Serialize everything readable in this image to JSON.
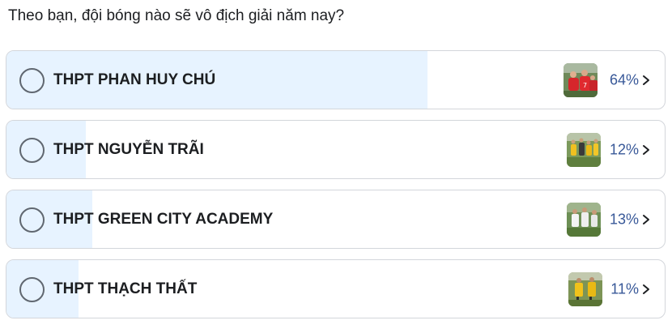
{
  "poll": {
    "question": "Theo bạn, đội bóng nào sẽ vô địch giải năm nay?",
    "options": [
      {
        "label": "THPT PHAN HUY CHÚ",
        "percent_text": "64%",
        "percent": 64,
        "image_icon": "team-photo-red-jerseys"
      },
      {
        "label": "THPT NGUYỄN TRÃI",
        "percent_text": "12%",
        "percent": 12,
        "image_icon": "team-photo-yellow-jerseys"
      },
      {
        "label": "THPT GREEN CITY ACADEMY",
        "percent_text": "13%",
        "percent": 13,
        "image_icon": "team-photo-white-jerseys"
      },
      {
        "label": "THPT THẠCH THẤT",
        "percent_text": "11%",
        "percent": 11,
        "image_icon": "team-photo-yellow-players"
      }
    ]
  },
  "colors": {
    "fill": "#e7f3ff",
    "border": "#d3d6db",
    "percent": "#385898",
    "radio": "#606770",
    "text": "#1c1e21"
  }
}
